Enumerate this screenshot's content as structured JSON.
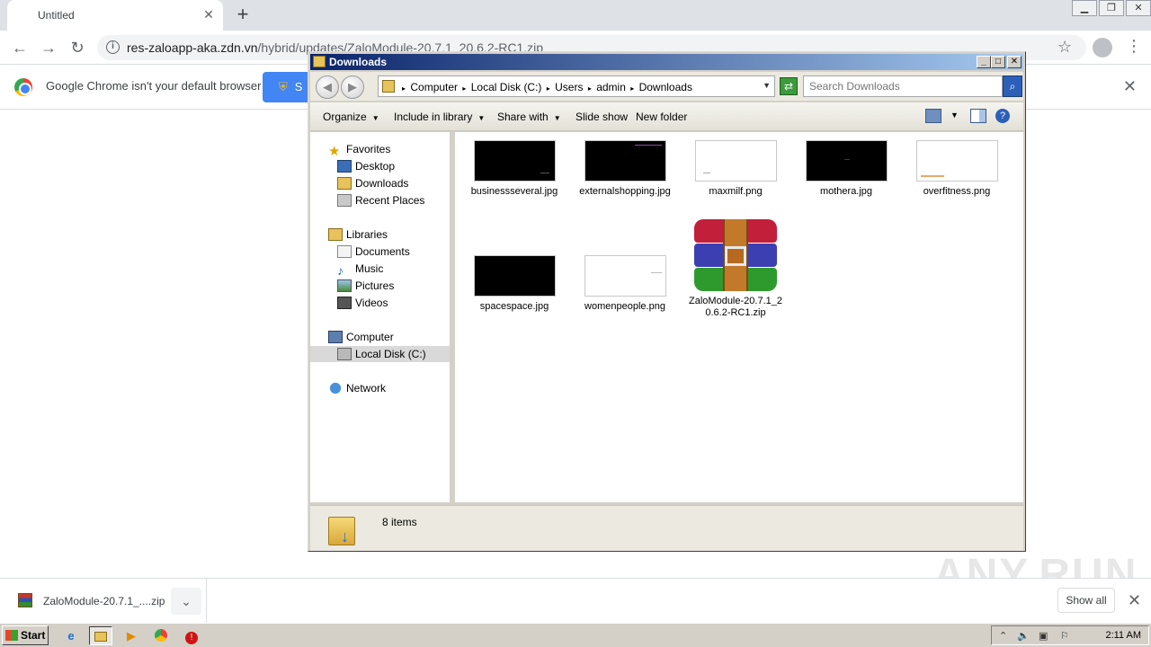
{
  "chrome": {
    "tab_title": "Untitled",
    "url_host": "res-zaloapp-aka.zdn.vn",
    "url_rest": "/hybrid/updates/ZaloModule-20.7.1_20.6.2-RC1.zip",
    "infobar_message": "Google Chrome isn't your default browser",
    "infobar_button": "S",
    "download_filename": "ZaloModule-20.7.1_....zip",
    "show_all": "Show all"
  },
  "explorer": {
    "title": "Downloads",
    "breadcrumbs": [
      "Computer",
      "Local Disk (C:)",
      "Users",
      "admin",
      "Downloads"
    ],
    "search_placeholder": "Search Downloads",
    "commands": {
      "organize": "Organize",
      "include_in_library": "Include in library",
      "share_with": "Share with",
      "slide_show": "Slide show",
      "new_folder": "New folder"
    },
    "nav": {
      "favorites": "Favorites",
      "desktop": "Desktop",
      "downloads": "Downloads",
      "recent_places": "Recent Places",
      "libraries": "Libraries",
      "documents": "Documents",
      "music": "Music",
      "pictures": "Pictures",
      "videos": "Videos",
      "computer": "Computer",
      "local_disk": "Local Disk (C:)",
      "network": "Network"
    },
    "files": [
      {
        "name": "businessseveral.jpg",
        "thumb": "black"
      },
      {
        "name": "externalshopping.jpg",
        "thumb": "black"
      },
      {
        "name": "maxmilf.png",
        "thumb": "white"
      },
      {
        "name": "mothera.jpg",
        "thumb": "black"
      },
      {
        "name": "overfitness.png",
        "thumb": "white"
      },
      {
        "name": "spacespace.jpg",
        "thumb": "black"
      },
      {
        "name": "womenpeople.png",
        "thumb": "white"
      },
      {
        "name": "ZaloModule-20.7.1_20.6.2-RC1.zip",
        "thumb": "winrar-icon"
      }
    ],
    "item_count": "8 items"
  },
  "taskbar": {
    "start": "Start",
    "clock": "2:11 AM"
  },
  "watermark": "ANY.RUN"
}
